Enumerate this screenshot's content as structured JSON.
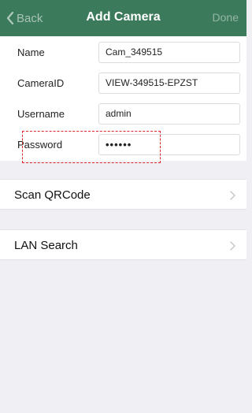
{
  "navbar": {
    "back_label": "Back",
    "title": "Add Camera",
    "done_label": "Done",
    "background": "#3b7a5a"
  },
  "form": {
    "rows": [
      {
        "label": "Name",
        "value": "Cam_349515"
      },
      {
        "label": "CameraID",
        "value": "VIEW-349515-EPZST"
      },
      {
        "label": "Username",
        "value": "admin"
      },
      {
        "label": "Password",
        "value": "••••••"
      }
    ]
  },
  "menu": {
    "items": [
      {
        "label": "Scan QRCode",
        "icon": "chevron-right-icon"
      },
      {
        "label": "LAN Search",
        "icon": "chevron-right-icon"
      }
    ]
  },
  "highlight_color": "#d9262b"
}
